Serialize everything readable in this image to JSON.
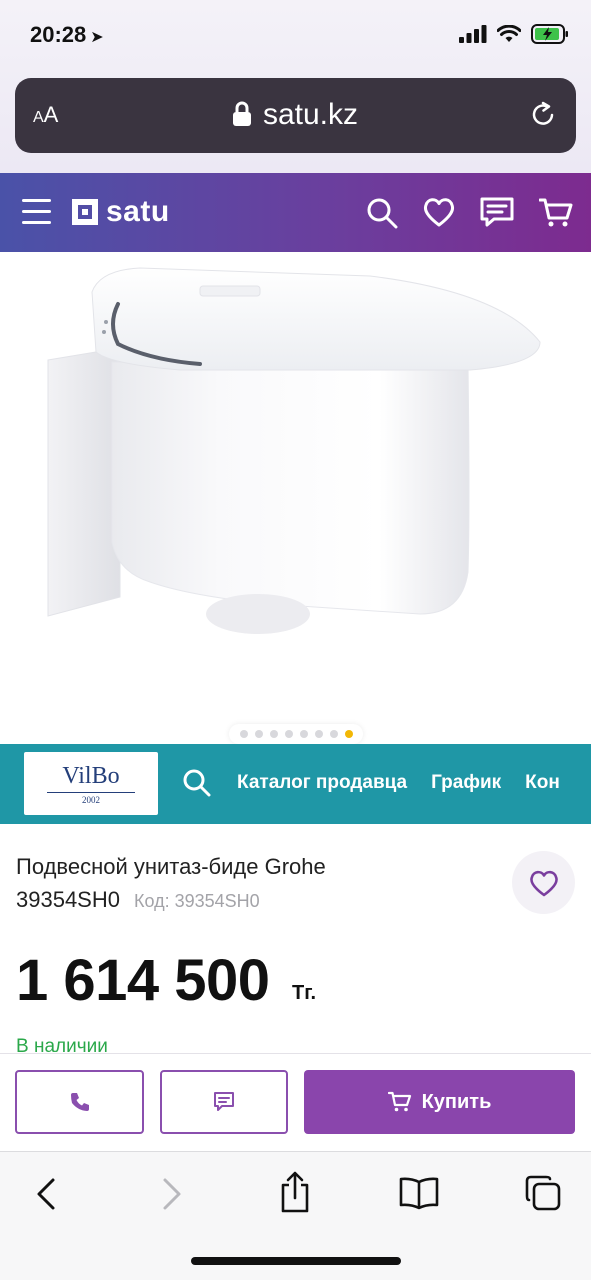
{
  "status_bar": {
    "time": "20:28"
  },
  "browser": {
    "aa_label": "AA",
    "url": "satu.kz"
  },
  "site_header": {
    "logo_text": "satu"
  },
  "gallery": {
    "image_count": 8,
    "active_index": 7,
    "accent_color": "#f2b705"
  },
  "seller": {
    "logo_name": "VilBo",
    "logo_year": "2002",
    "links": [
      "Каталог продавца",
      "График",
      "Кон"
    ]
  },
  "product": {
    "title": "Подвесной унитаз-биде Grohe 39354SH0",
    "code_label": "Код: 39354SH0",
    "price": "1 614 500",
    "currency": "Тг.",
    "stock": "В наличии"
  },
  "actions": {
    "buy_label": "Купить",
    "buy_color": "#8a45ac"
  },
  "colors": {
    "header_start": "#4a52a8",
    "header_end": "#7d2b8f",
    "seller_bar": "#1f97a6",
    "stock": "#2aa84a"
  }
}
